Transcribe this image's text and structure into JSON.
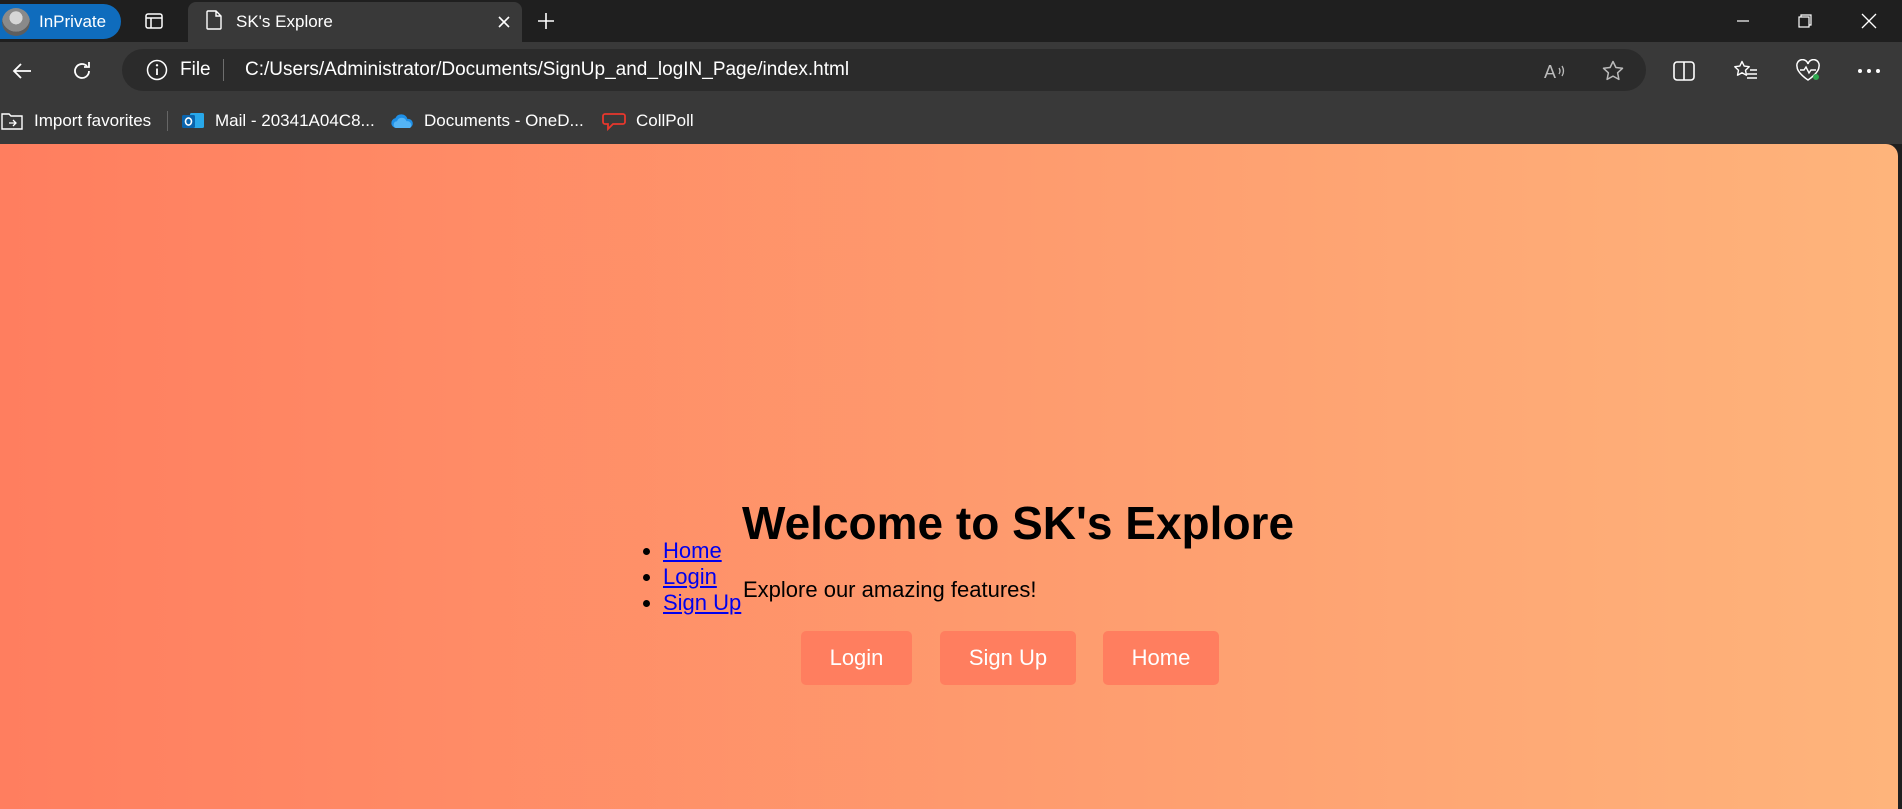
{
  "browser": {
    "inprivate_label": "InPrivate",
    "tab_title": "SK's Explore",
    "address": {
      "scheme": "File",
      "url": "C:/Users/Administrator/Documents/SignUp_and_logIN_Page/index.html"
    },
    "favorites": [
      {
        "label": "Import favorites",
        "icon": "import-favorites-icon"
      },
      {
        "label": "Mail - 20341A04C8...",
        "icon": "outlook-icon"
      },
      {
        "label": "Documents - OneD...",
        "icon": "onedrive-icon"
      },
      {
        "label": "CollPoll",
        "icon": "collpoll-icon"
      }
    ],
    "colors": {
      "chrome_dark": "#1f1f1f",
      "chrome_toolbar": "#393939",
      "inprivate_accent": "#0f6cbd"
    }
  },
  "page": {
    "nav_links": [
      {
        "label": "Home"
      },
      {
        "label": "Login"
      },
      {
        "label": "Sign Up"
      }
    ],
    "title": "Welcome to SK's Explore",
    "subtitle": "Explore our amazing features!",
    "buttons": [
      {
        "label": "Login"
      },
      {
        "label": "Sign Up"
      },
      {
        "label": "Home"
      }
    ],
    "colors": {
      "gradient_start": "#ff7e5f",
      "gradient_end": "#feb47b",
      "button_bg": "#ff7e5f",
      "button_text": "#ffffff",
      "link": "#0000ee"
    }
  }
}
